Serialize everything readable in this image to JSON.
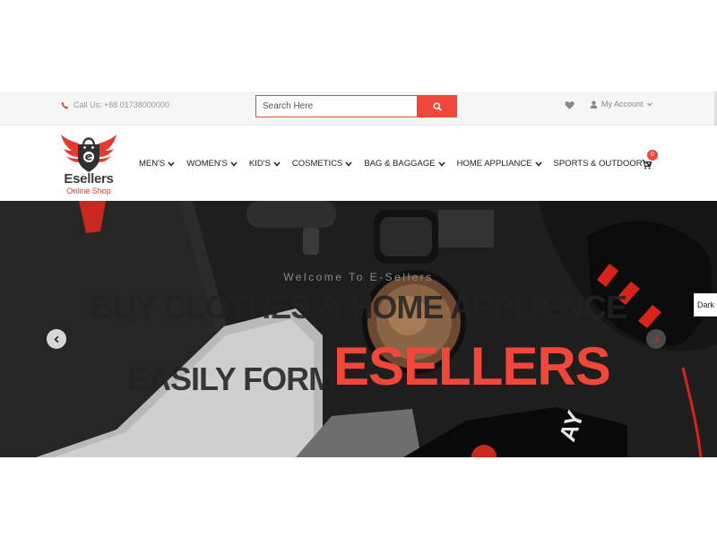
{
  "topbar": {
    "call_text": "Call Us: +88 01738000000",
    "search_placeholder": "Search Here",
    "account_label": "My Account"
  },
  "logo": {
    "brand": "Esellers",
    "tagline": "Online Shop"
  },
  "nav": {
    "items": [
      {
        "label": "MEN'S"
      },
      {
        "label": "WOMEN'S"
      },
      {
        "label": "KID'S"
      },
      {
        "label": "COSMETICS"
      },
      {
        "label": "BAG & BAGGAGE"
      },
      {
        "label": "HOME APPLIANCE"
      },
      {
        "label": "SPORTS & OUTDOOR"
      }
    ],
    "cart_count": "0"
  },
  "hero": {
    "welcome": "Welcome To E-Sellers",
    "line1": "BUY CLOTHES & HOME APPLIENCE",
    "line2": "EASILY FORM",
    "accent": "ESELLERS"
  },
  "dark_toggle_label": "Dark",
  "colors": {
    "accent": "#f0473a",
    "topbar_bg": "#f6f6f6",
    "hero_bg": "#1b1b1b"
  },
  "icons": {
    "phone": "phone-icon",
    "search": "search-icon",
    "heart": "heart-icon",
    "user": "user-icon",
    "cart": "cart-icon",
    "prev": "chevron-left-icon",
    "next": "chevron-right-icon"
  }
}
